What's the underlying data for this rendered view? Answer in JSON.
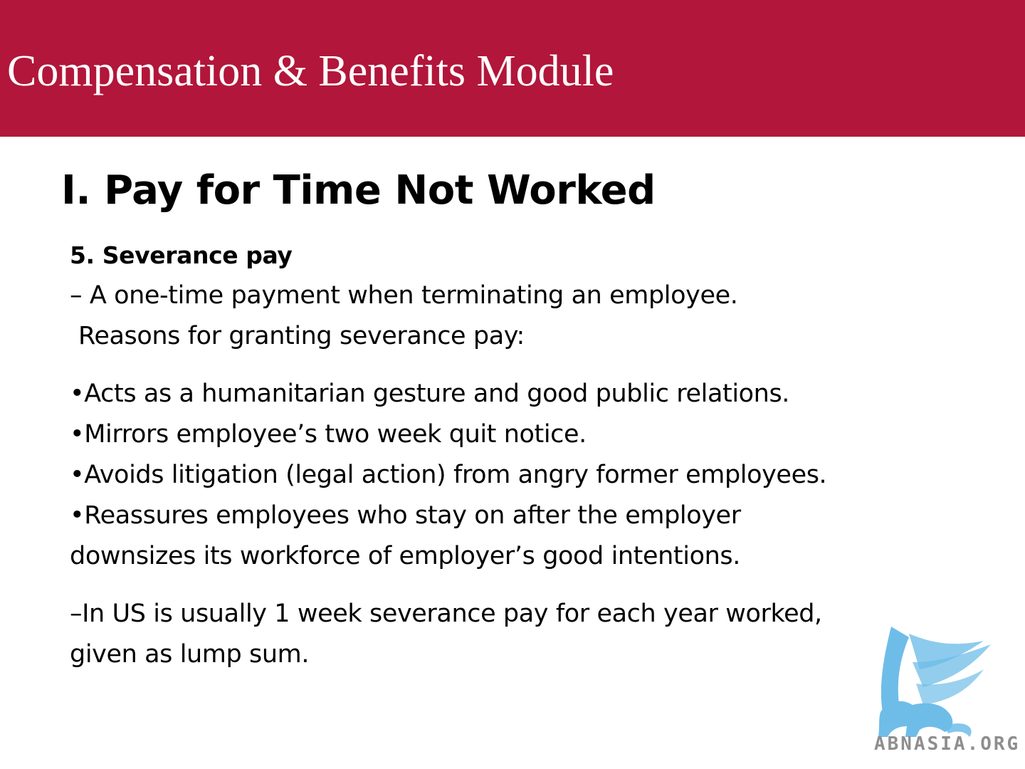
{
  "header": {
    "title": "Compensation & Benefits Module"
  },
  "slide": {
    "heading": "I. Pay for Time Not Worked",
    "subhead": "5. Severance pay",
    "definition": "– A one-time payment when terminating an employee.",
    "reasons_intro": "Reasons for granting severance pay:",
    "bullets": [
      "•Acts as a humanitarian gesture and good public relations.",
      "•Mirrors employee’s two week quit notice.",
      "•Avoids litigation (legal action) from angry former employees.",
      "•Reassures employees who stay on after the employer",
      "downsizes its workforce of employer’s good intentions."
    ],
    "note": [
      "–In US is usually 1 week severance pay for each year worked,",
      "given as lump sum."
    ]
  },
  "watermark": {
    "text": "ABNASIA.ORG"
  },
  "colors": {
    "banner": "#b2163a",
    "logo": "#5fb6e6"
  }
}
